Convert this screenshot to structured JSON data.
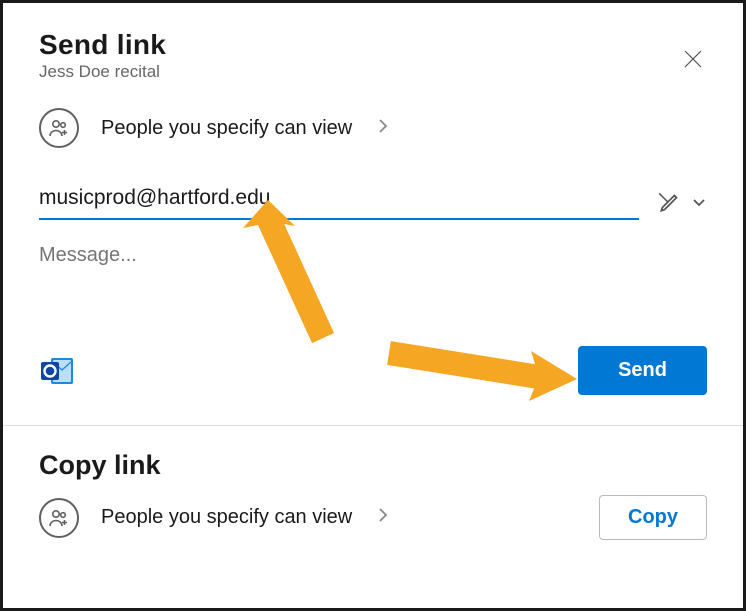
{
  "header": {
    "title": "Send link",
    "subtitle": "Jess Doe recital"
  },
  "permission": {
    "label": "People you specify can view"
  },
  "recipient": {
    "value": "musicprod@hartford.edu"
  },
  "message": {
    "placeholder": "Message..."
  },
  "actions": {
    "send_label": "Send"
  },
  "copySection": {
    "title": "Copy link",
    "permission_label": "People you specify can view",
    "copy_label": "Copy"
  },
  "colors": {
    "accent": "#0078d4",
    "arrow": "#f5a623"
  }
}
